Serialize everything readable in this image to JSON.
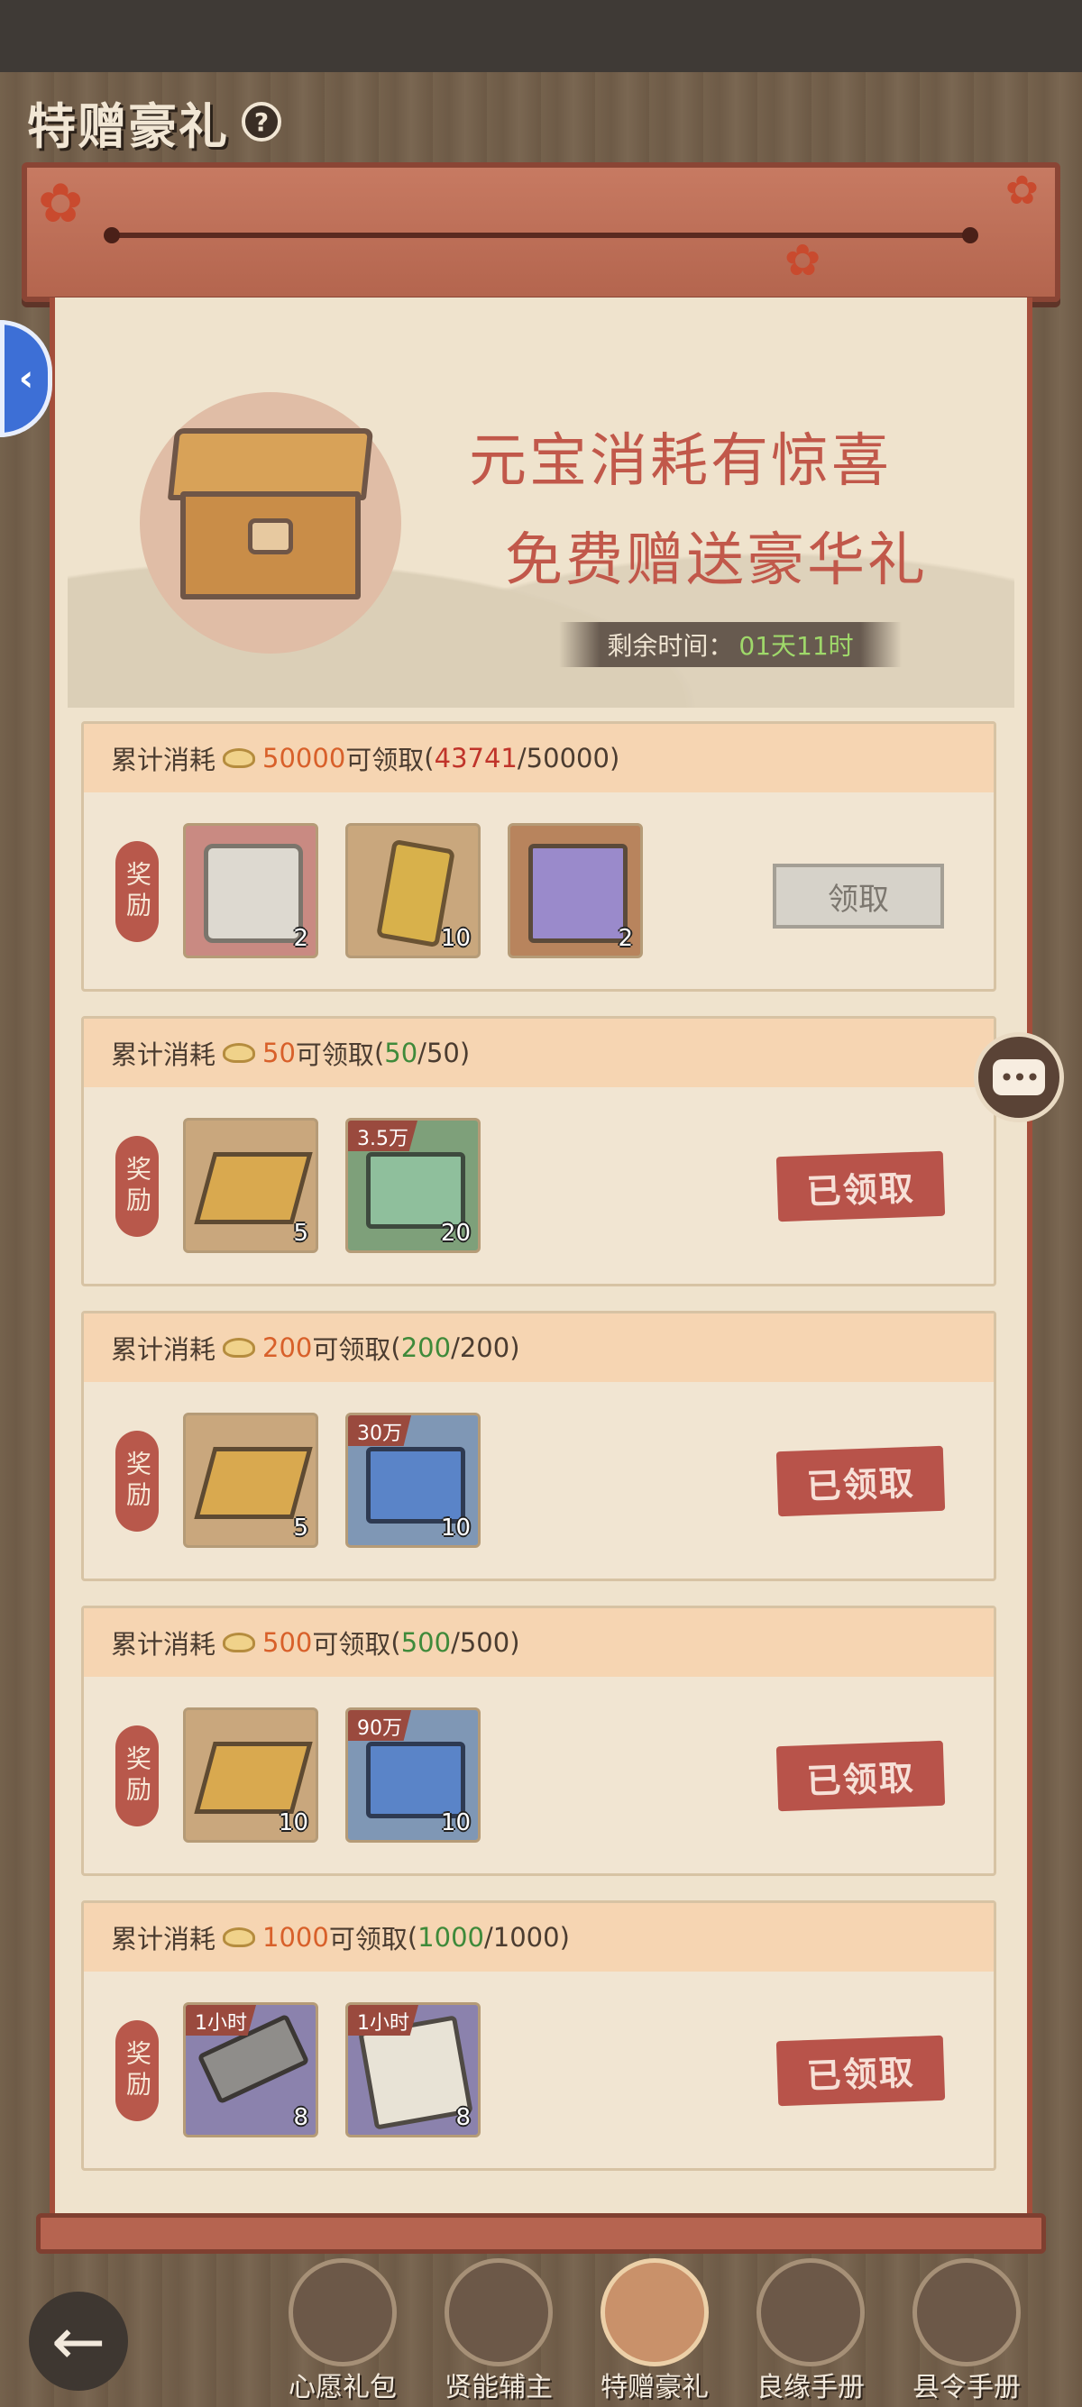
{
  "header": {
    "title": "特赠豪礼",
    "help": "?"
  },
  "banner": {
    "line1": "元宝消耗有惊喜",
    "line2": "免费赠送豪华礼",
    "timer_label": "剩余时间：",
    "timer_value": "01天11时"
  },
  "common": {
    "prefix": "累计消耗",
    "suffix": "可领取",
    "reward_label": "奖励"
  },
  "tiers": [
    {
      "target": "50000",
      "progress": "43741",
      "total": "50000",
      "status": "领取",
      "items": [
        {
          "icon": "bronze-cauldron-icon",
          "count": "2",
          "badge": ""
        },
        {
          "icon": "gold-token-icon",
          "count": "10",
          "badge": ""
        },
        {
          "icon": "ticket-crate-icon",
          "count": "2",
          "badge": ""
        }
      ]
    },
    {
      "target": "50",
      "progress": "50",
      "total": "50",
      "status": "已领取",
      "items": [
        {
          "icon": "gold-bars-icon",
          "count": "5",
          "badge": ""
        },
        {
          "icon": "green-chest-icon",
          "count": "20",
          "badge": "3.5万"
        }
      ]
    },
    {
      "target": "200",
      "progress": "200",
      "total": "200",
      "status": "已领取",
      "items": [
        {
          "icon": "gold-bars-icon",
          "count": "5",
          "badge": ""
        },
        {
          "icon": "blue-chest-icon",
          "count": "10",
          "badge": "30万"
        }
      ]
    },
    {
      "target": "500",
      "progress": "500",
      "total": "500",
      "status": "已领取",
      "items": [
        {
          "icon": "gold-bars-icon",
          "count": "10",
          "badge": ""
        },
        {
          "icon": "blue-chest-icon",
          "count": "10",
          "badge": "90万"
        }
      ]
    },
    {
      "target": "1000",
      "progress": "1000",
      "total": "1000",
      "status": "已领取",
      "items": [
        {
          "icon": "hammer-speedup-icon",
          "count": "8",
          "badge": "1小时"
        },
        {
          "icon": "scroll-speedup-icon",
          "count": "8",
          "badge": "1小时"
        }
      ]
    }
  ],
  "nav": [
    {
      "label": "心愿礼包"
    },
    {
      "label": "贤能辅主"
    },
    {
      "label": "特赠豪礼"
    },
    {
      "label": "良缘手册"
    },
    {
      "label": "县令手册"
    }
  ],
  "colors": {
    "accent_red": "#c1584a",
    "progress_green": "#3f8a3a",
    "value_orange": "#d8602a"
  }
}
